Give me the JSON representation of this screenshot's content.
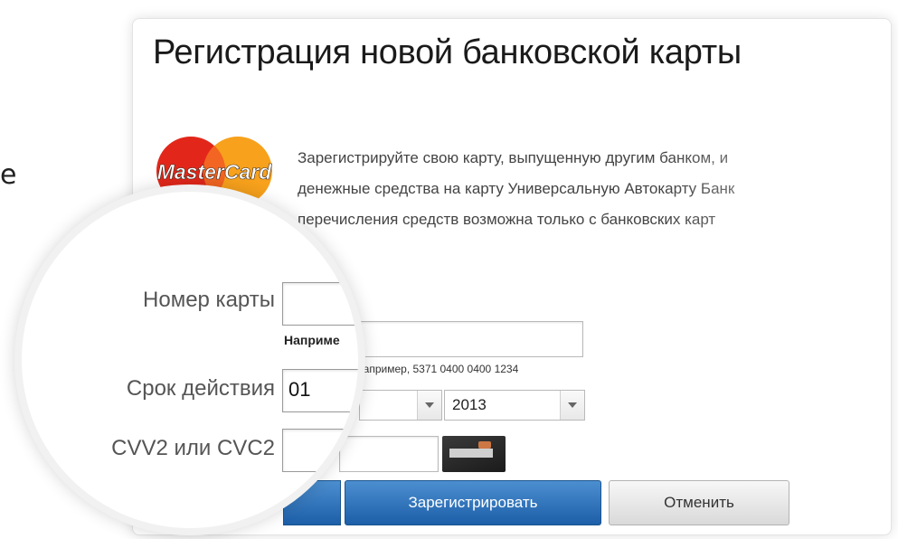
{
  "stray_text": "е",
  "title": "Регистрация новой банковской карты",
  "logo": {
    "text": "MasterCard",
    "colors": {
      "red": "#e2271a",
      "orange": "#f7a11c"
    }
  },
  "description": [
    "Зарегистрируйте свою карту, выпущенную другим банком, и",
    "денежные средства на карту Универсальную Автокарту Банк",
    "перечисления средств возможна только с банковских карт"
  ],
  "form": {
    "card_number": {
      "label": "Номер карты",
      "value": "",
      "hint": "Например, 5371 0400 0400 1234",
      "hint_zoomed": "Наприме"
    },
    "expiry": {
      "label": "Срок действия",
      "month": "01",
      "year": "2013"
    },
    "cvv": {
      "label": "CVV2 или CVC2",
      "value": ""
    }
  },
  "buttons": {
    "register": "Зарегистрировать",
    "cancel": "Отменить"
  },
  "accent": "#1d5fa8"
}
